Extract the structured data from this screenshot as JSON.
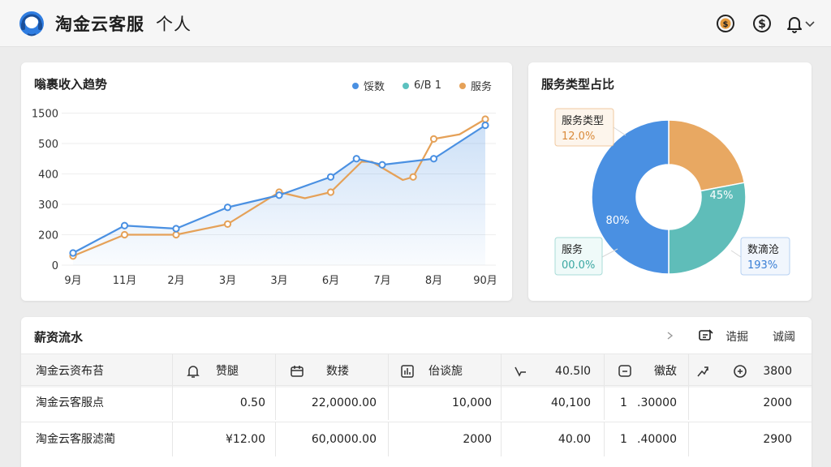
{
  "header": {
    "title": "淘金云客服",
    "subtitle": "个人"
  },
  "colors": {
    "blue": "#4a90e2",
    "teal": "#5cc1bf",
    "orange": "#e5a158"
  },
  "icons": [
    "headset-logo-icon",
    "coin-icon",
    "dollar-icon",
    "bell-icon",
    "chevron-down-icon",
    "more-arrow-icon",
    "edit-icon",
    "bell-outline-icon",
    "calendar-icon",
    "bar-chart-icon",
    "cursor-icon",
    "message-icon",
    "trend-arrow-icon",
    "coin-refresh-icon"
  ],
  "line_chart": {
    "title": "嗡裹收入趋势",
    "legend": [
      "馁数",
      "6/B 1",
      "服务"
    ]
  },
  "donut_chart": {
    "title": "服务类型占比",
    "labels": [
      {
        "name": "服务类型",
        "value": "12.0%"
      },
      {
        "name": "服务",
        "value": "00.0%"
      },
      {
        "name": "数滴沧",
        "value": "193%"
      }
    ],
    "slice_labels": [
      "45%",
      "80%"
    ]
  },
  "chart_data": [
    {
      "type": "line",
      "title": "嗡裹收入趋势",
      "categories": [
        "9月",
        "11月",
        "2月",
        "3月",
        "3月",
        "6月",
        "7月",
        "8月",
        "90月"
      ],
      "yticks": [
        "0",
        "200",
        "300",
        "400",
        "500",
        "1500"
      ],
      "ylim": [
        0,
        6
      ],
      "grid": true,
      "legend_position": "top-right",
      "series": [
        {
          "name": "馁数",
          "color": "#4a90e2",
          "area": true,
          "x": [
            0,
            1,
            2,
            3,
            4,
            5,
            5.5,
            6,
            7,
            8
          ],
          "values": [
            0.4,
            1.3,
            1.2,
            1.9,
            2.3,
            2.9,
            3.5,
            3.3,
            3.5,
            4.6
          ]
        },
        {
          "name": "服务",
          "color": "#e5a158",
          "area": false,
          "x": [
            0,
            1,
            2,
            3,
            4,
            4.5,
            5,
            5.6,
            5.8,
            6.4,
            6.6,
            7,
            7.5,
            8
          ],
          "values": [
            0.3,
            1.0,
            1.0,
            1.35,
            2.4,
            2.2,
            2.4,
            3.4,
            3.4,
            2.8,
            2.9,
            4.15,
            4.3,
            4.8
          ]
        }
      ]
    },
    {
      "type": "pie",
      "title": "服务类型占比",
      "labels": [
        "服务类型",
        "服务",
        "数滴沧"
      ],
      "values": [
        22,
        28,
        50
      ],
      "colors": [
        "#e8a862",
        "#5fbdb9",
        "#4a90e2"
      ]
    }
  ],
  "table": {
    "title": "薪资流水",
    "actions": [
      "诰掘",
      "诚阈"
    ],
    "header": [
      "淘金云资布苔",
      "赞腿",
      "数搂",
      "佁谈旎",
      "40.5l0",
      "徽敌",
      "3800"
    ],
    "rows": [
      [
        "淘金云客服点",
        "0.50",
        "22,0000.00",
        "10,000",
        "40,100",
        "1",
        ".30000",
        "2000"
      ],
      [
        "淘金云客服滤蔺",
        "¥12.00",
        "60,0000.00",
        "2000",
        "40.00",
        "1",
        ".40000",
        "2900"
      ]
    ]
  }
}
